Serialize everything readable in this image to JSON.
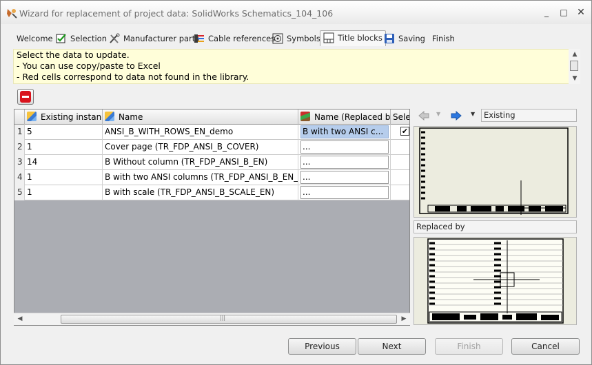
{
  "window": {
    "title": "Wizard for replacement of project data: SolidWorks Schematics_104_106"
  },
  "tabs": [
    {
      "label": "Welcome",
      "icon": "none"
    },
    {
      "label": "Selection",
      "icon": "green-check-icon"
    },
    {
      "label": "Manufacturer parts",
      "icon": "tools-icon"
    },
    {
      "label": "Cable references",
      "icon": "cable-icon"
    },
    {
      "label": "Symbols",
      "icon": "symbol-icon"
    },
    {
      "label": "Title blocks",
      "icon": "title-block-icon"
    },
    {
      "label": "Saving",
      "icon": "floppy-disk-icon"
    },
    {
      "label": "Finish",
      "icon": "none"
    }
  ],
  "active_tab": "Title blocks",
  "info": {
    "line1": "Select the data to update.",
    "line2": "- You can use copy/paste to Excel",
    "line3": "- Red cells correspond to data not found in the library."
  },
  "grid": {
    "columns": {
      "existing": "Existing instance",
      "name": "Name",
      "replaced": "Name (Replaced by)",
      "select": "Sele"
    },
    "rows": [
      {
        "num": "1",
        "existing": "5",
        "name": "ANSI_B_WITH_ROWS_EN_demo",
        "replaced": "B with two ANSI c...",
        "checked": "✔"
      },
      {
        "num": "2",
        "existing": "1",
        "name": "Cover page (TR_FDP_ANSI_B_COVER)",
        "replaced": "...",
        "checked": ""
      },
      {
        "num": "3",
        "existing": "14",
        "name": "B Without column (TR_FDP_ANSI_B_EN)",
        "replaced": "...",
        "checked": ""
      },
      {
        "num": "4",
        "existing": "1",
        "name": "B with two ANSI columns (TR_FDP_ANSI_B_EN_LINE)",
        "replaced": "...",
        "checked": ""
      },
      {
        "num": "5",
        "existing": "1",
        "name": "B with scale (TR_FDP_ANSI_B_SCALE_EN)",
        "replaced": "...",
        "checked": ""
      }
    ],
    "scroll_grip": "|||"
  },
  "preview": {
    "existing_label": "Existing",
    "replaced_label": "Replaced by"
  },
  "buttons": {
    "previous": "Previous",
    "next": "Next",
    "finish": "Finish",
    "cancel": "Cancel"
  },
  "colors": {
    "info_background": "#fffed9",
    "delete_icon": "#d9131c",
    "selected_cell": "#b6cdec"
  }
}
